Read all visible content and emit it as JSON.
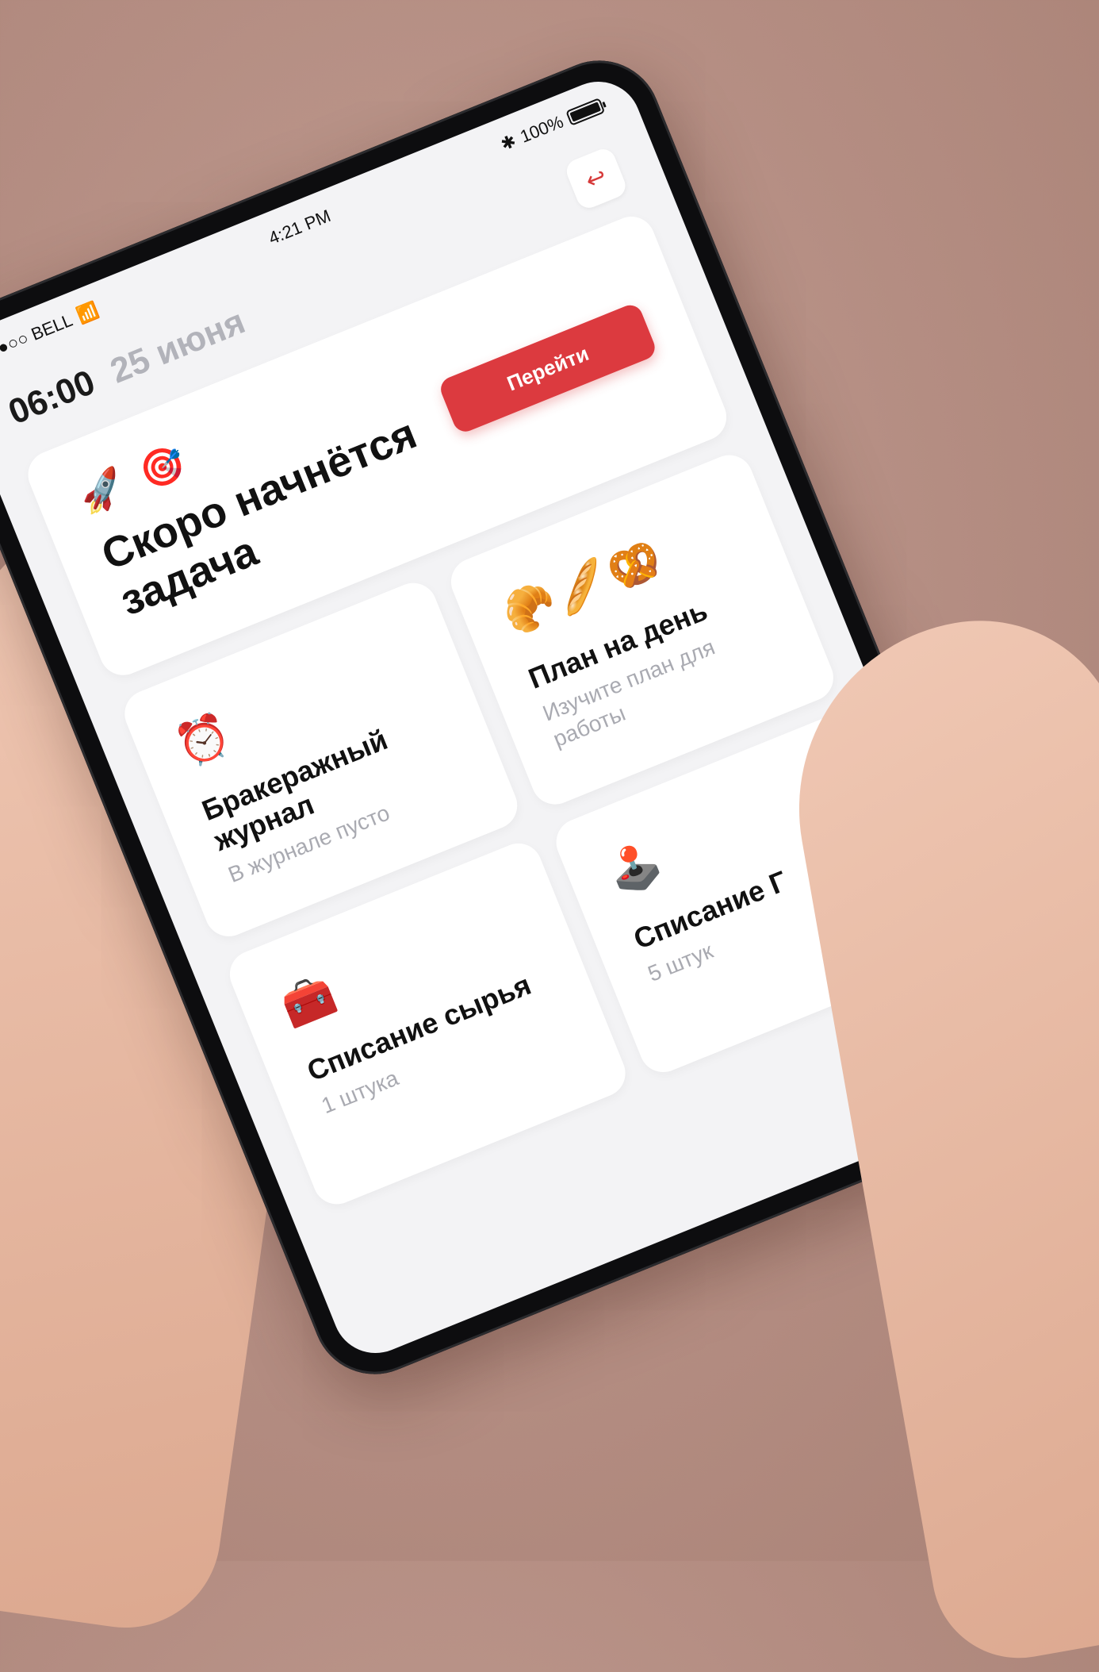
{
  "status_bar": {
    "carrier": "●●●○○ BELL",
    "clock": "4:21 PM",
    "battery": "100%"
  },
  "header": {
    "time": "06:00",
    "date": "25 июня",
    "logout_icon": "logout-arrow-icon"
  },
  "hero": {
    "emojis": "🚀 🎯",
    "title": "Скоро начнётся задача",
    "button_label": "Перейти"
  },
  "tiles": [
    {
      "emoji": "⏰",
      "title": "Бракеражный журнал",
      "subtitle": "В журнале пусто"
    },
    {
      "emoji": "🥐🥖🥨",
      "title": "План на день",
      "subtitle": "Изучите план для работы"
    },
    {
      "emoji": "🧰",
      "title": "Списание сырья",
      "subtitle": "1 штука"
    },
    {
      "emoji": "🕹️",
      "title": "Списание Г",
      "subtitle": "5 штук"
    }
  ],
  "colors": {
    "accent": "#dc3a3f",
    "muted_text": "#a9aab1",
    "screen_bg": "#f3f3f5"
  }
}
